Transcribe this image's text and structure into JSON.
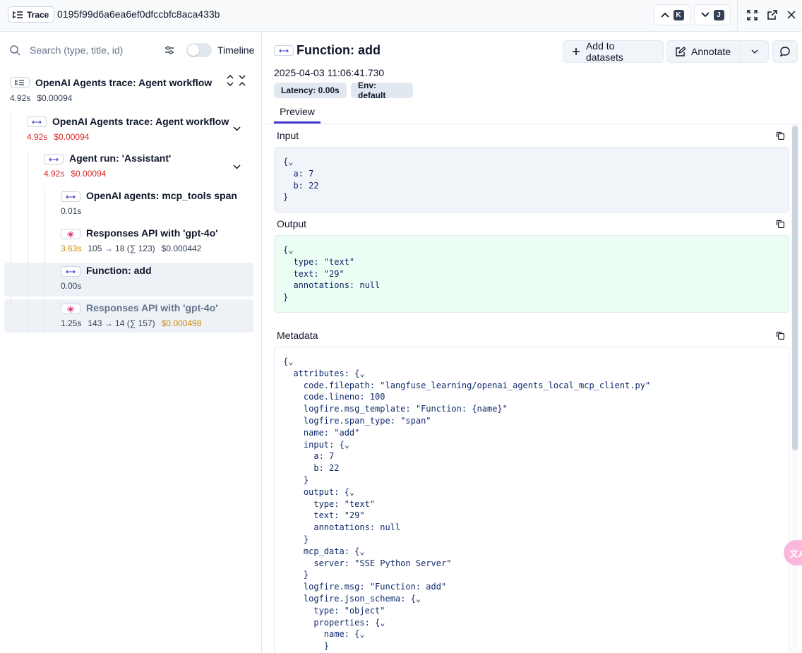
{
  "topbar": {
    "badge_label": "Trace",
    "trace_id": "0195f99d6a6ea6ef0dfccbfc8aca433b",
    "prev_key": "K",
    "next_key": "J"
  },
  "left": {
    "search_placeholder": "Search (type, title, id)",
    "timeline_label": "Timeline",
    "nodes": [
      {
        "title": "OpenAI Agents trace: Agent workflow",
        "duration": "4.92s",
        "cost": "$0.00094"
      },
      {
        "title": "OpenAI Agents trace: Agent workflow",
        "duration": "4.92s",
        "cost": "$0.00094"
      },
      {
        "title": "Agent run: 'Assistant'",
        "duration": "4.92s",
        "cost": "$0.00094"
      },
      {
        "title": "OpenAI agents: mcp_tools span",
        "duration": "0.01s"
      },
      {
        "title": "Responses API with 'gpt-4o'",
        "duration": "3.63s",
        "tokens": "105 → 18 (∑ 123)",
        "cost": "$0.000442"
      },
      {
        "title": "Function: add",
        "duration": "0.00s"
      },
      {
        "title": "Responses API with 'gpt-4o'",
        "duration": "1.25s",
        "tokens": "143 → 14 (∑ 157)",
        "cost": "$0.000498"
      }
    ]
  },
  "right": {
    "title": "Function: add",
    "add_to_datasets": "Add to datasets",
    "annotate": "Annotate",
    "timestamp": "2025-04-03 11:06:41.730",
    "latency_pill": "Latency: 0.00s",
    "env_pill": "Env: default",
    "tab_preview": "Preview",
    "input_label": "Input",
    "output_label": "Output",
    "metadata_label": "Metadata",
    "input_lines": [
      "{⌄",
      "  a: 7",
      "  b: 22",
      "}"
    ],
    "output_lines": [
      "{⌄",
      "  type: \"text\"",
      "  text: \"29\"",
      "  annotations: null",
      "}"
    ],
    "metadata_lines": [
      "{⌄",
      "  attributes: {⌄",
      "    code.filepath: \"langfuse_learning/openai_agents_local_mcp_client.py\"",
      "    code.lineno: 100",
      "    logfire.msg_template: \"Function: {name}\"",
      "    logfire.span_type: \"span\"",
      "    name: \"add\"",
      "    input: {⌄",
      "      a: 7",
      "      b: 22",
      "    }",
      "    output: {⌄",
      "      type: \"text\"",
      "      text: \"29\"",
      "      annotations: null",
      "    }",
      "    mcp_data: {⌄",
      "      server: \"SSE Python Server\"",
      "    }",
      "    logfire.msg: \"Function: add\"",
      "    logfire.json_schema: {⌄",
      "      type: \"object\"",
      "      properties: {⌄",
      "        name: {⌄",
      "        }"
    ],
    "fab_label": "文A"
  }
}
